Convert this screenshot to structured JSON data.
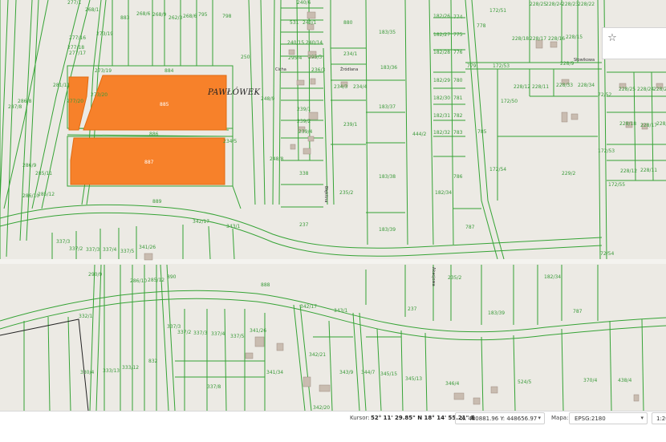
{
  "map": {
    "place_name": "PAWŁÓWEK",
    "highlighted_parcels": [
      {
        "id": "885",
        "color": "#f7812a"
      },
      {
        "id": "887",
        "color": "#f7812a"
      }
    ],
    "parcel_labels_top": [
      "277/1",
      "268/6",
      "883",
      "268/6",
      "262/3",
      "268/6",
      "795",
      "798",
      "240/6",
      "531",
      "240/1",
      "880",
      "183/35",
      "182/26",
      "774",
      "778",
      "172/51",
      "228/25",
      "228/24",
      "228/23",
      "228/22",
      "277/18",
      "277/16",
      "273/19",
      "273/19",
      "884",
      "250",
      "240/15",
      "240/14",
      "295/4",
      "295/3",
      "234/1",
      "182/27",
      "775",
      "228/18",
      "228/17",
      "228/16",
      "228/15",
      "182/28",
      "776",
      "277/17",
      "273/20",
      "281/11",
      "886",
      "248/9",
      "236/3",
      "234/3",
      "234/4",
      "183/36",
      "182/29",
      "779",
      "172/53",
      "228/9",
      "228/12",
      "228/11",
      "228/33",
      "228/34",
      "182/30",
      "780",
      "286/8",
      "287/8",
      "239/1",
      "183/37",
      "182/31",
      "781",
      "172/50",
      "182/32",
      "782",
      "239/2",
      "239/3",
      "239/4",
      "444/2",
      "182/33",
      "783",
      "785",
      "72/52",
      "228/18",
      "228/17",
      "228/26",
      "228/25",
      "228/24",
      "234/5",
      "248/8",
      "338",
      "183/38",
      "786",
      "172/54",
      "229/2",
      "228/12",
      "228/11",
      "286/9",
      "285/11",
      "286/10",
      "285/12",
      "235/2",
      "182/34",
      "172/53",
      "889",
      "342/17",
      "343/1",
      "237",
      "183/39",
      "787",
      "72/54",
      "337/3",
      "337/2",
      "337/3",
      "337/4",
      "337/5",
      "341/26"
    ],
    "parcel_labels_bottom": [
      "286/9",
      "286/10",
      "285/12",
      "888",
      "235/2",
      "182/34",
      "342/17",
      "343/1",
      "237",
      "183/39",
      "787",
      "332/1",
      "337/3",
      "337/2",
      "337/3",
      "337/4",
      "337/5",
      "341/26",
      "342/21",
      "330/4",
      "333/13",
      "333/12",
      "832",
      "341/34",
      "343/9",
      "344/7",
      "345/15",
      "345/13",
      "346/4",
      "524/5",
      "370/4",
      "438/4",
      "337/8",
      "342/20"
    ],
    "streets": [
      "Cicha",
      "Źródlana",
      "Błękitna",
      "Słowikowa",
      "Akacjowa"
    ]
  },
  "toolbar": {
    "favorite_icon": "star-icon"
  },
  "statusbar": {
    "kursor_label": "Kursor:",
    "kursor_value": "52° 11' 29.85\" N 18° 14' 55.21\" E",
    "xy_value": "X: 480881.96 Y: 448656.97",
    "mapa_label": "Mapa:",
    "mapa_value": "EPSG:2180",
    "scale_value": "1:20"
  }
}
